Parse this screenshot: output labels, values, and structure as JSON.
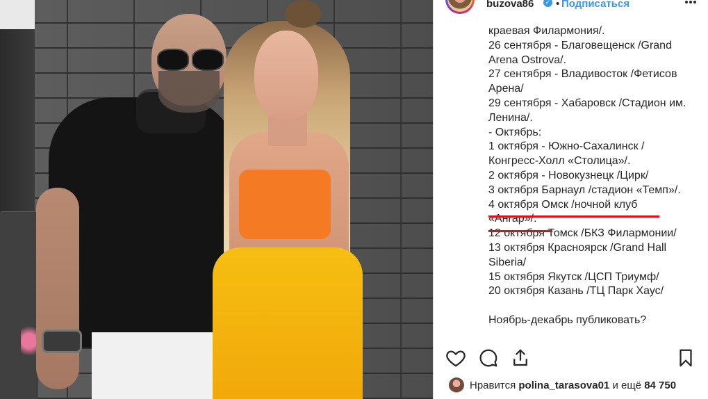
{
  "header": {
    "username": "buzova86",
    "separator": "•",
    "follow_label": "Подписаться"
  },
  "caption": {
    "lines": [
      "краевая Филармония/.",
      "26 сентября - Благовещенск /Grand",
      "Arena Ostrova/.",
      "27 сентября - Владивосток /Фетисов",
      "Арена/",
      "29 сентября - Хабаровск /Стадион им.",
      "Ленина/.",
      "- Октябрь:",
      "1 октября - Южно-Сахалинск /",
      "Конгресс-Холл «Столица»/.",
      "2 октября - Новокузнецк /Цирк/",
      "3 октября Барнаул /стадион «Темп»/.",
      "4 октября Омск /ночной клуб",
      "«Ангар»/.",
      "12 октября Томск /БКЗ Филармонии/",
      "13 октября Красноярск /Grand Hall",
      "Siberia/",
      "15 октября Якутск /ЦСП Триумф/",
      "20 октября Казань /ТЦ Парк Хаус/",
      "",
      "Ноябрь-декабрь публиковать?"
    ],
    "highlight_color": "#e00f1f"
  },
  "likes": {
    "prefix": "Нравится",
    "user": "polina_tarasova01",
    "middle": "и ещё",
    "count": "84 750"
  },
  "icons": {
    "like": "heart-icon",
    "comment": "comment-icon",
    "share": "share-icon",
    "save": "bookmark-icon"
  },
  "colors": {
    "link": "#3897f0",
    "text": "#262626",
    "underline": "#e00f1f"
  }
}
